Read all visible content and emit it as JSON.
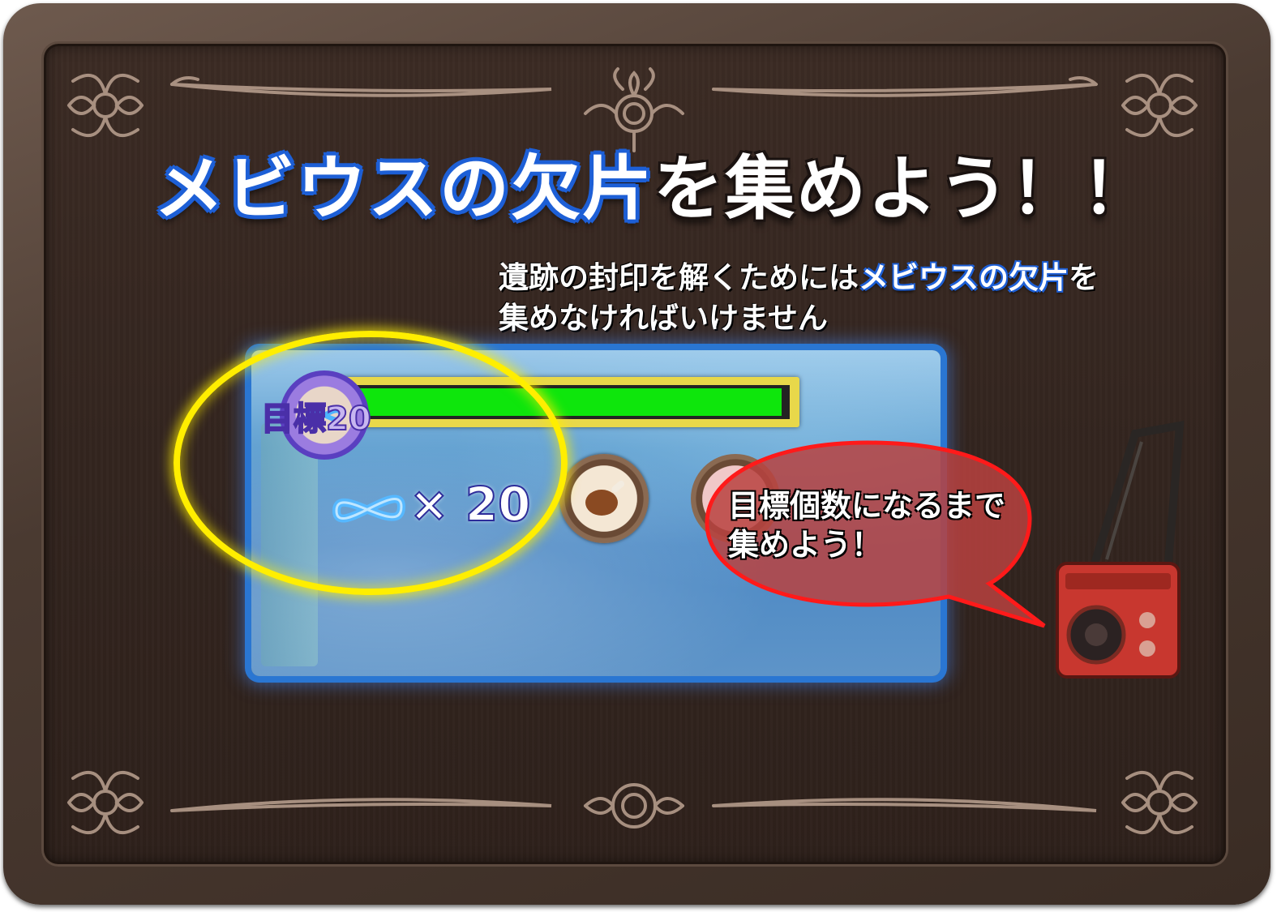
{
  "title": {
    "part_blue": "メビウスの欠片",
    "part_white": "を集めよう！！"
  },
  "description": {
    "line1_pre": "遺跡の封印を解くためには",
    "line1_highlight": "メビウスの欠片",
    "line1_post": "を",
    "line2": "集めなければいけません"
  },
  "hud": {
    "goal_label": "目標20",
    "item_count": "× 20",
    "progress_fraction": 1.0
  },
  "speech": {
    "line1": "目標個数になるまで",
    "line2": "集めよう！"
  },
  "colors": {
    "frame": "#4a3a31",
    "title_outline_blue": "#1d5fd6",
    "highlight_ring": "#ffee00",
    "progress_fill": "#0ee60c",
    "speech_bubble": "#b8423f"
  },
  "icons": [
    "mobius-fragment-icon",
    "meat-icon",
    "radio-mascot-icon",
    "ornament-flourish-icon"
  ]
}
